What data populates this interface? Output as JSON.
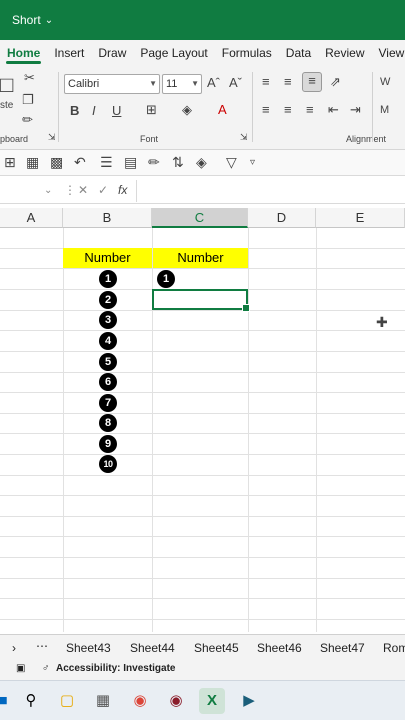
{
  "titlebar": {
    "title": "Short",
    "chevron": "chevron-down-icon"
  },
  "ribbon_tabs": [
    "Home",
    "Insert",
    "Draw",
    "Page Layout",
    "Formulas",
    "Data",
    "Review",
    "View"
  ],
  "active_tab": "Home",
  "ribbon": {
    "paste_label": "ste",
    "clipboard_label": "pboard",
    "font_name": "Calibri",
    "font_size": "11",
    "font_group_label": "Font",
    "alignment_group_label": "Alignment",
    "bold": "B",
    "italic": "I",
    "underline": "U",
    "wrap_label": "W",
    "merge_label": "M"
  },
  "formula_bar": {
    "fx": "fx",
    "value": ""
  },
  "columns": [
    "A",
    "B",
    "C",
    "D",
    "E"
  ],
  "selected_column": "C",
  "sheet": {
    "header_b": "Number",
    "header_c": "Number",
    "column_b_values": [
      "1",
      "2",
      "3",
      "4",
      "5",
      "6",
      "7",
      "8",
      "9",
      "10"
    ],
    "column_c_values": [
      "1"
    ]
  },
  "sheet_tabs": [
    "Sheet43",
    "Sheet44",
    "Sheet45",
    "Sheet46",
    "Sheet47",
    "Rom"
  ],
  "status": {
    "accessibility": "Accessibility: Investigate"
  },
  "colors": {
    "accent": "#107c41",
    "highlight": "#ffff00"
  }
}
